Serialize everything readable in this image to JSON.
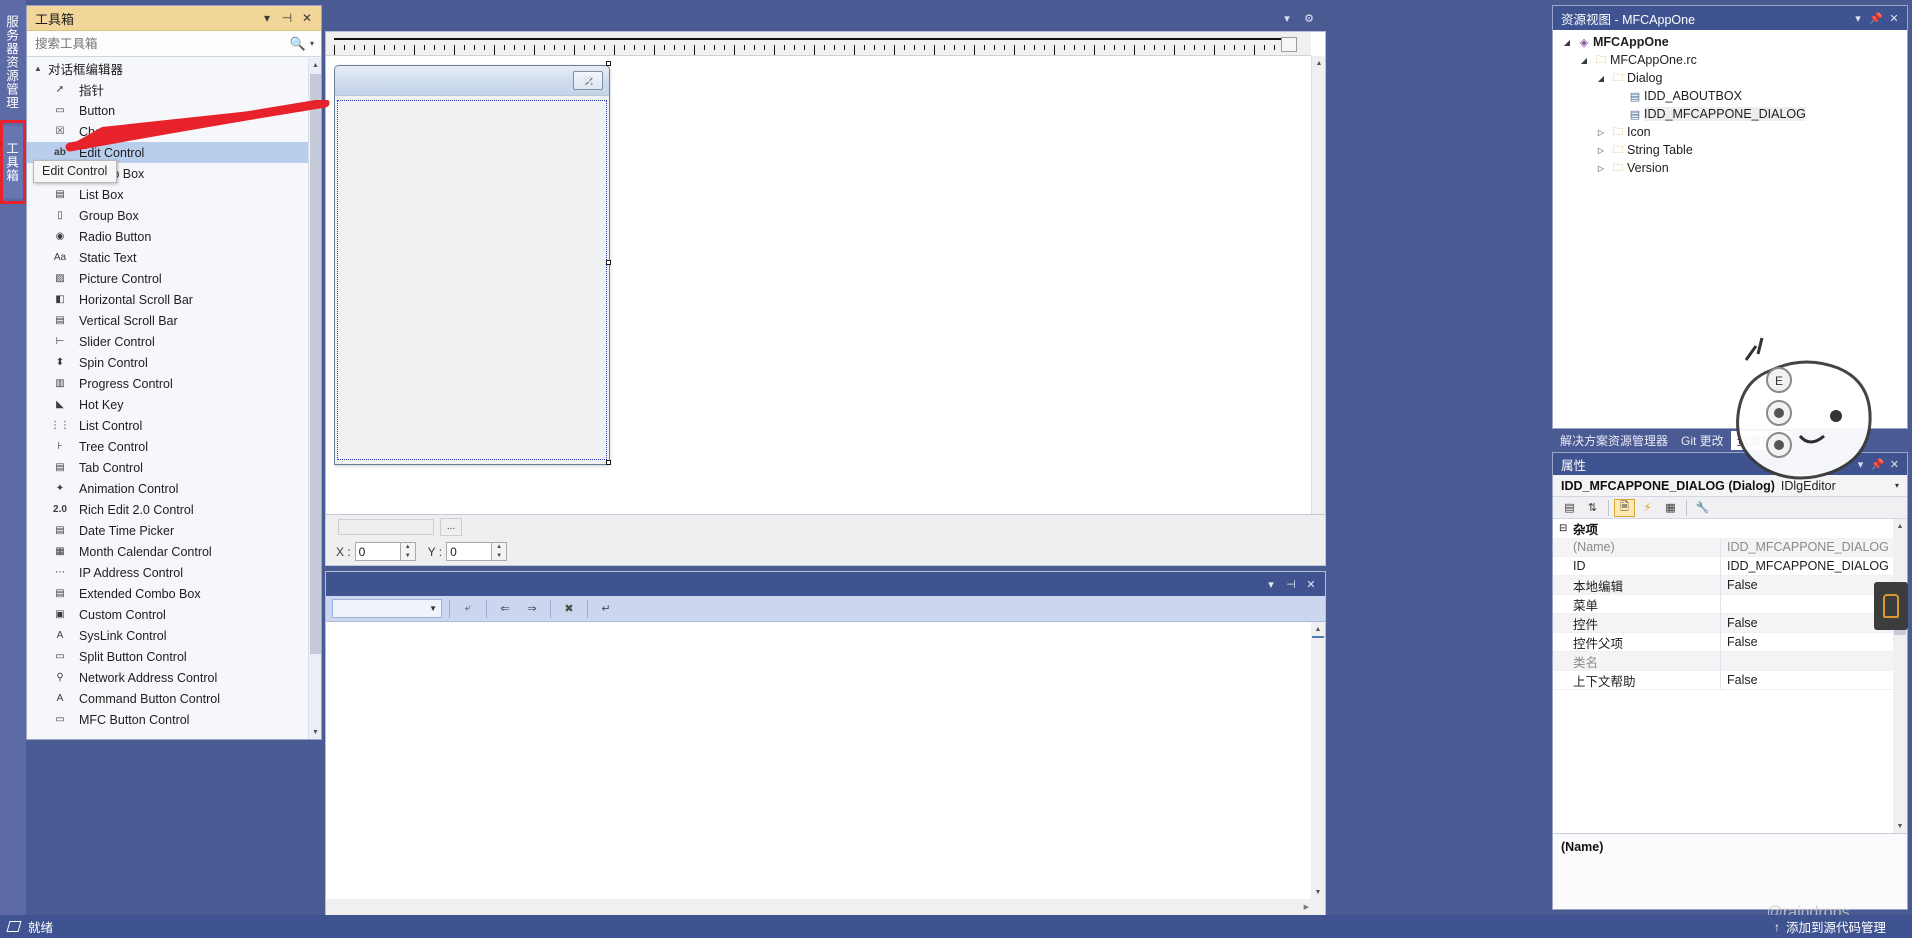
{
  "vertical_tabs": [
    {
      "label": "服务器资源管理器",
      "name": "server-explorer"
    },
    {
      "label": "工具箱",
      "name": "toolbox"
    }
  ],
  "toolbox": {
    "title": "工具箱",
    "search_placeholder": "搜索工具箱",
    "group_label": "对话框编辑器",
    "tooltip": "Edit Control",
    "selected_item": "Edit Control",
    "items": [
      {
        "label": "指针",
        "icon": "pointer-icon"
      },
      {
        "label": "Button",
        "icon": "button-icon"
      },
      {
        "label": "Check Box",
        "icon": "checkbox-icon"
      },
      {
        "label": "Edit Control",
        "icon": "edit-control-icon"
      },
      {
        "label": "Combo Box",
        "icon": "combo-box-icon"
      },
      {
        "label": "List Box",
        "icon": "list-box-icon"
      },
      {
        "label": "Group Box",
        "icon": "group-box-icon"
      },
      {
        "label": "Radio Button",
        "icon": "radio-button-icon"
      },
      {
        "label": "Static Text",
        "icon": "static-text-icon"
      },
      {
        "label": "Picture Control",
        "icon": "picture-control-icon"
      },
      {
        "label": "Horizontal Scroll Bar",
        "icon": "h-scrollbar-icon"
      },
      {
        "label": "Vertical Scroll Bar",
        "icon": "v-scrollbar-icon"
      },
      {
        "label": "Slider Control",
        "icon": "slider-icon"
      },
      {
        "label": "Spin Control",
        "icon": "spin-icon"
      },
      {
        "label": "Progress Control",
        "icon": "progress-icon"
      },
      {
        "label": "Hot Key",
        "icon": "hotkey-icon"
      },
      {
        "label": "List Control",
        "icon": "list-control-icon"
      },
      {
        "label": "Tree Control",
        "icon": "tree-control-icon"
      },
      {
        "label": "Tab Control",
        "icon": "tab-control-icon"
      },
      {
        "label": "Animation Control",
        "icon": "animation-icon"
      },
      {
        "label": "Rich Edit 2.0 Control",
        "icon": "rich-edit-icon"
      },
      {
        "label": "Date Time Picker",
        "icon": "date-time-icon"
      },
      {
        "label": "Month Calendar Control",
        "icon": "calendar-icon"
      },
      {
        "label": "IP Address Control",
        "icon": "ip-address-icon"
      },
      {
        "label": "Extended Combo Box",
        "icon": "ext-combo-icon"
      },
      {
        "label": "Custom Control",
        "icon": "custom-control-icon"
      },
      {
        "label": "SysLink Control",
        "icon": "syslink-icon"
      },
      {
        "label": "Split Button Control",
        "icon": "split-button-icon"
      },
      {
        "label": "Network Address Control",
        "icon": "network-address-icon"
      },
      {
        "label": "Command Button Control",
        "icon": "command-button-icon"
      },
      {
        "label": "MFC Button Control",
        "icon": "mfc-button-icon"
      }
    ]
  },
  "editor": {
    "dialog_close_label": "✕",
    "x_label": "X :",
    "x_value": "0",
    "y_label": "Y :",
    "y_value": "0",
    "dots_label": "..."
  },
  "output": {
    "title": "",
    "combo_value": ""
  },
  "resource_view": {
    "title": "资源视图 - MFCAppOne",
    "tree": [
      {
        "label": "MFCAppOne",
        "indent": 0,
        "expander": "▲",
        "icon": "solution-icon",
        "bold": true,
        "selected": false
      },
      {
        "label": "MFCAppOne.rc",
        "indent": 1,
        "expander": "▲",
        "icon": "folder-open-icon",
        "bold": false,
        "selected": false
      },
      {
        "label": "Dialog",
        "indent": 2,
        "expander": "▲",
        "icon": "folder-open-icon",
        "bold": false,
        "selected": false
      },
      {
        "label": "IDD_ABOUTBOX",
        "indent": 3,
        "expander": "",
        "icon": "dialog-resource-icon",
        "bold": false,
        "selected": false
      },
      {
        "label": "IDD_MFCAPPONE_DIALOG",
        "indent": 3,
        "expander": "",
        "icon": "dialog-resource-icon",
        "bold": false,
        "selected": true
      },
      {
        "label": "Icon",
        "indent": 2,
        "expander": "▷",
        "icon": "folder-icon",
        "bold": false,
        "selected": false
      },
      {
        "label": "String Table",
        "indent": 2,
        "expander": "▷",
        "icon": "folder-icon",
        "bold": false,
        "selected": false
      },
      {
        "label": "Version",
        "indent": 2,
        "expander": "▷",
        "icon": "folder-icon",
        "bold": false,
        "selected": false
      }
    ],
    "tabs": [
      {
        "label": "解决方案资源管理器",
        "active": false
      },
      {
        "label": "Git 更改",
        "active": false
      },
      {
        "label": "资源视图",
        "active": true
      }
    ]
  },
  "properties": {
    "title": "属性",
    "object_name": "IDD_MFCAPPONE_DIALOG (Dialog)",
    "object_class": "IDlgEditor",
    "toolbar_buttons": [
      {
        "name": "categorized-button",
        "glyph": "▤",
        "active": false
      },
      {
        "name": "alphabetical-button",
        "glyph": "⇅",
        "active": false
      },
      {
        "name": "properties-page-button",
        "glyph": "🗎",
        "active": true
      },
      {
        "name": "events-button",
        "glyph": "⚡",
        "active": false
      },
      {
        "name": "messages-button",
        "glyph": "▦",
        "active": false
      },
      {
        "name": "property-pages-button",
        "glyph": "🔧",
        "active": false
      }
    ],
    "category": "杂项",
    "rows": [
      {
        "key": "(Name)",
        "value": "IDD_MFCAPPONE_DIALOG (",
        "dim": true
      },
      {
        "key": "ID",
        "value": "IDD_MFCAPPONE_DIALOG",
        "dim": false
      },
      {
        "key": "本地编辑",
        "value": "False",
        "dim": false
      },
      {
        "key": "菜单",
        "value": "",
        "dim": false
      },
      {
        "key": "控件",
        "value": "False",
        "dim": false
      },
      {
        "key": "控件父项",
        "value": "False",
        "dim": false
      },
      {
        "key": "类名",
        "value": "",
        "dim": true
      },
      {
        "key": "上下文帮助",
        "value": "False",
        "dim": false
      }
    ],
    "description_header": "(Name)"
  },
  "status_bar": {
    "ready": "就绪",
    "source_control": "添加到源代码管理",
    "watermark": "@raindrops."
  },
  "colors": {
    "chrome": "#3f5390",
    "shell_bg": "#4a5a93",
    "toolbox_title": "#f2d699",
    "selection": "#b9cdec",
    "annotation": "#e8222a"
  }
}
